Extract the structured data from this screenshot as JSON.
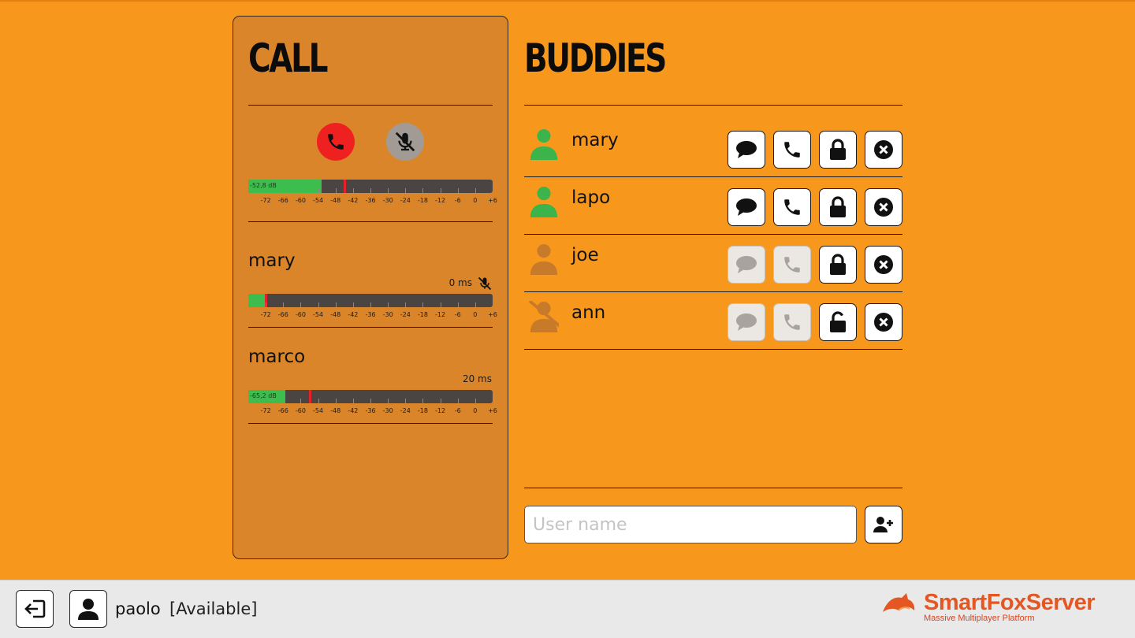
{
  "call": {
    "title": "CALL",
    "end_call_icon": "phone-hangup-icon",
    "mute_icon": "mic-muted-icon",
    "local_meter": {
      "db_label": "-52,8 dB",
      "level_db": -52.8,
      "peak_db": -45
    },
    "scale_labels": [
      "-72",
      "-66",
      "-60",
      "-54",
      "-48",
      "-42",
      "-36",
      "-30",
      "-24",
      "-18",
      "-12",
      "-6",
      "0",
      "+6"
    ],
    "peers": [
      {
        "name": "mary",
        "latency": "0 ms",
        "muted": true,
        "db_label": "",
        "level_db": -72,
        "peak_db": -72
      },
      {
        "name": "marco",
        "latency": "20 ms",
        "muted": false,
        "db_label": "-65,2 dB",
        "level_db": -65.2,
        "peak_db": -57
      }
    ]
  },
  "buddies": {
    "title": "BUDDIES",
    "list": [
      {
        "name": "mary",
        "status": "online",
        "chat_enabled": true,
        "call_enabled": true,
        "lock": "locked"
      },
      {
        "name": "lapo",
        "status": "online",
        "chat_enabled": true,
        "call_enabled": true,
        "lock": "locked"
      },
      {
        "name": "joe",
        "status": "offline",
        "chat_enabled": false,
        "call_enabled": false,
        "lock": "locked"
      },
      {
        "name": "ann",
        "status": "blocked",
        "chat_enabled": false,
        "call_enabled": false,
        "lock": "unlocked"
      }
    ],
    "input_placeholder": "User name",
    "add_icon": "add-user-icon"
  },
  "bottom": {
    "logout_icon": "logout-icon",
    "avatar_icon": "user-icon",
    "user_name": "paolo",
    "user_status": "[Available]",
    "logo_text": "SmartFoxServer",
    "logo_sub": "Massive Multiplayer Platform"
  },
  "colors": {
    "background": "#f7981d",
    "panel": "#db852b",
    "online": "#3cb44b",
    "offline": "#c77a2a",
    "end_call": "#ef2020",
    "meter_fill": "#3dbd4d",
    "meter_peak": "#e8202a",
    "logo": "#e55722"
  }
}
